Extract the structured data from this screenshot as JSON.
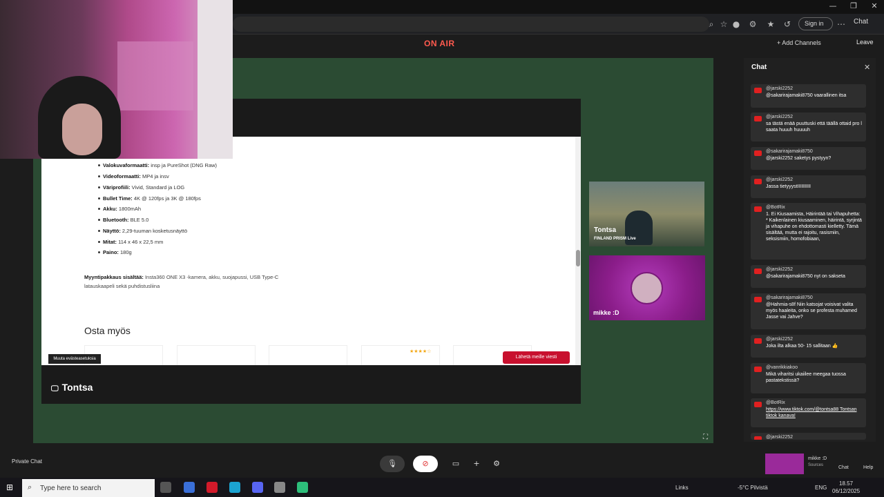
{
  "browser": {
    "sign_in_label": "Sign in",
    "chat_label": "Chat",
    "window_controls": [
      "—",
      "❐",
      "✕"
    ]
  },
  "studio": {
    "on_air": "ON AIR",
    "add_channels": "+ Add Channels",
    "leave": "Leave",
    "accent_color": "#ff5a4e",
    "stage_bg": "#2b4b33"
  },
  "shared_screen": {
    "name": "Tontsa",
    "specs": [
      {
        "key": "Valokuvaformaatti:",
        "val": " insp ja PureShot (DNG Raw)"
      },
      {
        "key": "Videoformaatti:",
        "val": " MP4 ja insv"
      },
      {
        "key": "Väriprofiili:",
        "val": " Vivid, Standard ja LOG"
      },
      {
        "key": "Bullet Time:",
        "val": " 4K @ 120fps ja 3K @ 180fps"
      },
      {
        "key": "Akku:",
        "val": "  1800mAh"
      },
      {
        "key": "Bluetooth:",
        "val": " BLE 5.0"
      },
      {
        "key": "Näyttö:",
        "val": "  2,29-tuuman kosketusnäyttö"
      },
      {
        "key": "Mitat:",
        "val": " 114 x 46 x 22,5 mm"
      },
      {
        "key": "Paino:",
        "val": " 180g"
      }
    ],
    "sales_package_key": "Myyntipakkaus sisältää:",
    "sales_package_val": " Insta360 ONE X3 -kamera, akku, suojapussi, USB Type-C latauskaapeli sekä puhdistusliina",
    "also_buy": "Osta myös",
    "cookie_button": "Muuta evästeasetuksia",
    "send_message": "Lähetä meille viesti",
    "stars": "★★★★☆"
  },
  "participants": [
    {
      "name": "Tontsa",
      "sub": "FINLAND        PRISM Live"
    },
    {
      "name": "mikke :D"
    }
  ],
  "chat": {
    "title": "Chat",
    "messages": [
      {
        "user": "@jarski2252",
        "text": "@sakarirajamaki8750 vaarallinen itsa"
      },
      {
        "user": "@jarski2252",
        "text": "sa tästä enää puuttuski että täällä ottaid pro l saata huuuh huuuuh"
      },
      {
        "user": "@sakarirajamaki8750",
        "text": "@jarski2252 saketys pystyyn?"
      },
      {
        "user": "@jarski2252",
        "text": "Jassa tietyyystIIIIIIIIII"
      },
      {
        "user": "@BotRix",
        "text": "1. Ei Kiusaamista, Häirintää tai Vihapuhetta: * Kaikenlainen kiusaaminen, häirintä, syrjintä ja vihapuhe on ehdottomasti kielletty. Tämä sisältää, mutta ei rajoitu, rasismiin, seksismiin, homofobiaan,"
      },
      {
        "user": "@jarski2252",
        "text": "@sakarirajamaki8750 nyt on sakseta"
      },
      {
        "user": "@sakarirajamaki8750",
        "text": "@Hahmia-s8f Niin katsojat voisivat valita myös haaleita, onko se profesta muhamed Jasse vai Jahve?"
      },
      {
        "user": "@jarski2252",
        "text": "Joka ilta alkaa 50- 15 sallitaan 👍"
      },
      {
        "user": "@vanrikkiakoo",
        "text": "Mikä viharitsi ukaiilee meegaa tuossa pastatekstissä?"
      },
      {
        "user": "@BotRix",
        "text": "https://www.tiktok.com/@tontsa88 Tontsan tiktok kanava!",
        "link": true
      },
      {
        "user": "@jarski2252",
        "text": ""
      }
    ]
  },
  "controls": {
    "private_chat": "Private Chat",
    "stage_name": "mikke :D",
    "stage_sub": "Sources",
    "chat": "Chat",
    "help": "Help"
  },
  "taskbar": {
    "search_placeholder": "Type here to search",
    "links": "Links",
    "weather": "-5°C  Pilvistä",
    "lang": "ENG",
    "time": "18.57",
    "date": "06/12/2025"
  }
}
